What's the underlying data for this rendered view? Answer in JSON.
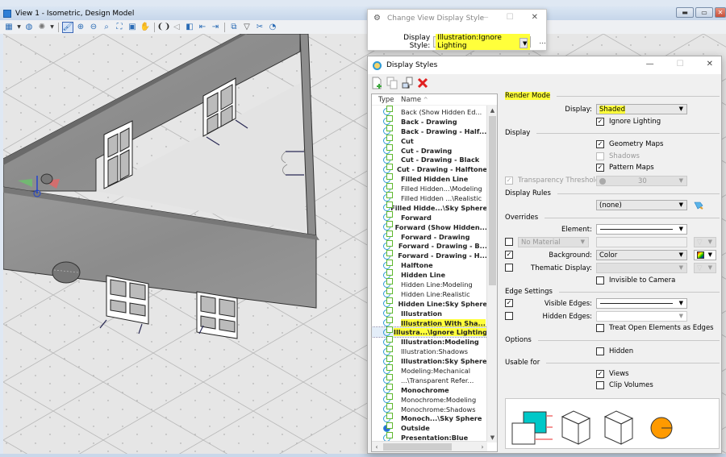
{
  "view_window": {
    "title": "View 1 - Isometric, Design Model",
    "toolbar": [
      "view-attributes",
      "display-style",
      "lighting",
      "update-view",
      "zoom-in",
      "zoom-out",
      "zoom-window",
      "fit-view",
      "window-area",
      "pan",
      "walk",
      "view-previous",
      "view-next",
      "copy-view",
      "view-rotate",
      "clip-volume",
      "clip-mask",
      "camera"
    ],
    "controls": {
      "minimize": "▬",
      "maximize": "▭",
      "close": "✕"
    }
  },
  "change_view_dialog": {
    "title": "Change View Display Style",
    "label": "Display Style:",
    "value": "Illustration:Ignore Lighting",
    "more": "...",
    "controls": {
      "minimize": "—",
      "maximize": "☐",
      "close": "✕"
    },
    "highlight_color": "#ffff3b"
  },
  "display_styles_dialog": {
    "title": "Display Styles",
    "controls": {
      "minimize": "—",
      "maximize": "☐",
      "close": "✕"
    },
    "tools": [
      "new-style",
      "copy-style",
      "import-style",
      "delete-style"
    ],
    "list": {
      "columns": [
        "Type",
        "Name"
      ],
      "items": [
        {
          "name": "Back (Show Hidden Ed...",
          "bold": false
        },
        {
          "name": "Back - Drawing",
          "bold": true
        },
        {
          "name": "Back - Drawing - Half...",
          "bold": true
        },
        {
          "name": "Cut",
          "bold": true
        },
        {
          "name": "Cut - Drawing",
          "bold": true
        },
        {
          "name": "Cut - Drawing - Black",
          "bold": true
        },
        {
          "name": "Cut - Drawing - Halftone",
          "bold": true
        },
        {
          "name": "Filled Hidden Line",
          "bold": true
        },
        {
          "name": "Filled Hidden...\\Modeling",
          "bold": false
        },
        {
          "name": "Filled Hidden ...\\Realistic",
          "bold": false
        },
        {
          "name": "Filled Hidde...\\Sky Sphere",
          "bold": true
        },
        {
          "name": "Forward",
          "bold": true
        },
        {
          "name": "Forward (Show Hidden...",
          "bold": true
        },
        {
          "name": "Forward - Drawing",
          "bold": true
        },
        {
          "name": "Forward - Drawing - B...",
          "bold": true
        },
        {
          "name": "Forward - Drawing - H...",
          "bold": true
        },
        {
          "name": "Halftone",
          "bold": true
        },
        {
          "name": "Hidden Line",
          "bold": true
        },
        {
          "name": "Hidden Line:Modeling",
          "bold": false
        },
        {
          "name": "Hidden Line:Realistic",
          "bold": false
        },
        {
          "name": "Hidden Line:Sky Sphere",
          "bold": true
        },
        {
          "name": "Illustration",
          "bold": true
        },
        {
          "name": "Illustration With Sha...",
          "bold": true,
          "highlight": true
        },
        {
          "name": "Illustra...\\Ignore Lighting",
          "bold": true,
          "highlight": true,
          "selected": true
        },
        {
          "name": "Illustration:Modeling",
          "bold": true
        },
        {
          "name": "Illustration:Shadows",
          "bold": false
        },
        {
          "name": "Illustration:Sky Sphere",
          "bold": true
        },
        {
          "name": "Modeling:Mechanical",
          "bold": false
        },
        {
          "name": "...\\Transparent Refer...",
          "bold": false
        },
        {
          "name": "Monochrome",
          "bold": true
        },
        {
          "name": "Monochrome:Modeling",
          "bold": false
        },
        {
          "name": "Monochrome:Shadows",
          "bold": false
        },
        {
          "name": "Monoch...\\Sky Sphere",
          "bold": true
        },
        {
          "name": "Outside",
          "bold": true,
          "type": "outside"
        },
        {
          "name": "Presentation:Blue",
          "bold": true
        }
      ]
    },
    "render_mode": {
      "section": "Render Mode",
      "display_label": "Display:",
      "display_value": "Shaded",
      "ignore_lighting": {
        "label": "Ignore Lighting",
        "checked": true
      }
    },
    "display": {
      "section": "Display",
      "geometry_maps": {
        "label": "Geometry Maps",
        "checked": true
      },
      "shadows": {
        "label": "Shadows",
        "checked": false,
        "disabled": true
      },
      "pattern_maps": {
        "label": "Pattern Maps",
        "checked": true
      },
      "transparency": {
        "label": "Transparency Threshold:",
        "checked": true,
        "disabled": true,
        "value": "30"
      }
    },
    "display_rules": {
      "section": "Display Rules",
      "value": "(none)"
    },
    "overrides": {
      "section": "Overrides",
      "element_label": "Element:",
      "material": {
        "checked": false,
        "value": "No Material"
      },
      "background": {
        "label": "Background:",
        "checked": true,
        "value": "Color"
      },
      "thematic": {
        "label": "Thematic Display:",
        "checked": false,
        "value": ""
      },
      "invisible_to_camera": {
        "label": "Invisible to Camera",
        "checked": false
      }
    },
    "edge_settings": {
      "section": "Edge Settings",
      "visible_edges": {
        "label": "Visible Edges:",
        "checked": true
      },
      "hidden_edges": {
        "label": "Hidden Edges:",
        "checked": false
      },
      "treat_open": {
        "label": "Treat Open Elements as Edges",
        "checked": false
      }
    },
    "options": {
      "section": "Options",
      "hidden": {
        "label": "Hidden",
        "checked": false
      }
    },
    "usable_for": {
      "section": "Usable for",
      "views": {
        "label": "Views",
        "checked": true
      },
      "clip_volumes": {
        "label": "Clip Volumes",
        "checked": false
      }
    },
    "preview_colors": {
      "cyan": "#00c8c8",
      "orange": "#ff9a00",
      "red": "#f07070"
    }
  }
}
